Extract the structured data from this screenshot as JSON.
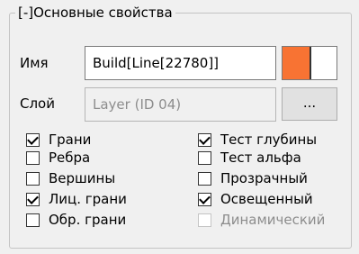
{
  "group": {
    "title": "[-]Основные свойства"
  },
  "name": {
    "label": "Имя",
    "value": "Build[Line[22780]]"
  },
  "layer": {
    "label": "Слой",
    "value": "Layer (ID 04)",
    "button": "..."
  },
  "colors": {
    "primary": "#f87333",
    "secondary": "#ffffff"
  },
  "checkboxes_left": [
    {
      "label": "Грани",
      "checked": true
    },
    {
      "label": "Ребра",
      "checked": false
    },
    {
      "label": "Вершины",
      "checked": false
    },
    {
      "label": "Лиц. грани",
      "checked": true
    },
    {
      "label": "Обр. грани",
      "checked": false
    }
  ],
  "checkboxes_right": [
    {
      "label": "Тест глубины",
      "checked": true
    },
    {
      "label": "Тест альфа",
      "checked": false
    },
    {
      "label": "Прозрачный",
      "checked": false
    },
    {
      "label": "Освещенный",
      "checked": true
    },
    {
      "label": "Динамический",
      "checked": false,
      "disabled": true
    }
  ]
}
